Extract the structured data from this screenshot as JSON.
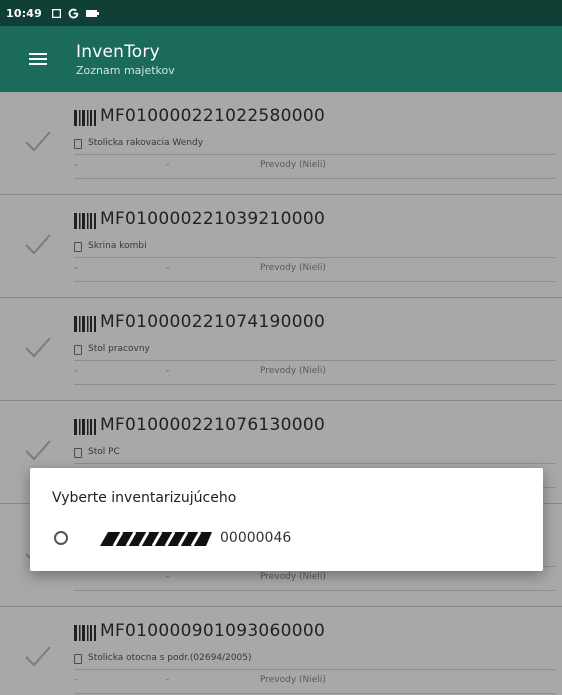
{
  "statusbar": {
    "time": "10:49",
    "icons": [
      "notification-square-icon",
      "google-icon",
      "battery-icon"
    ]
  },
  "appbar": {
    "title": "InvenTory",
    "subtitle": "Zoznam majetkov",
    "menu_icon": "hamburger-menu-icon"
  },
  "items": [
    {
      "code": "MF010000221022580000",
      "name": "Stolicka rakovacia Wendy",
      "f1": "-",
      "f2": "-",
      "f3": "Prevody (Nieli)"
    },
    {
      "code": "MF010000221039210000",
      "name": "Skrina kombi",
      "f1": "-",
      "f2": "-",
      "f3": "Prevody (Nieli)"
    },
    {
      "code": "MF010000221074190000",
      "name": "Stol pracovny",
      "f1": "-",
      "f2": "-",
      "f3": "Prevody (Nieli)"
    },
    {
      "code": "MF010000221076130000",
      "name": "Stol PC",
      "f1": "-",
      "f2": "-",
      "f3": "Prevody (Nieli)"
    },
    {
      "code": "",
      "name": "",
      "f1": "",
      "f2": "-",
      "f3": "Prevody (Nieli)"
    },
    {
      "code": "MF010000901093060000",
      "name": "Stolicka otocna s podr.(02694/2005)",
      "f1": "-",
      "f2": "-",
      "f3": "Prevody (Nieli)"
    }
  ],
  "dialog": {
    "title": "Vyberte inventarizujúceho",
    "option_text": "00000046"
  },
  "colors": {
    "statusbar": "#0f3f35",
    "appbar": "#1b6b5a",
    "dialog_bg": "#ffffff"
  }
}
